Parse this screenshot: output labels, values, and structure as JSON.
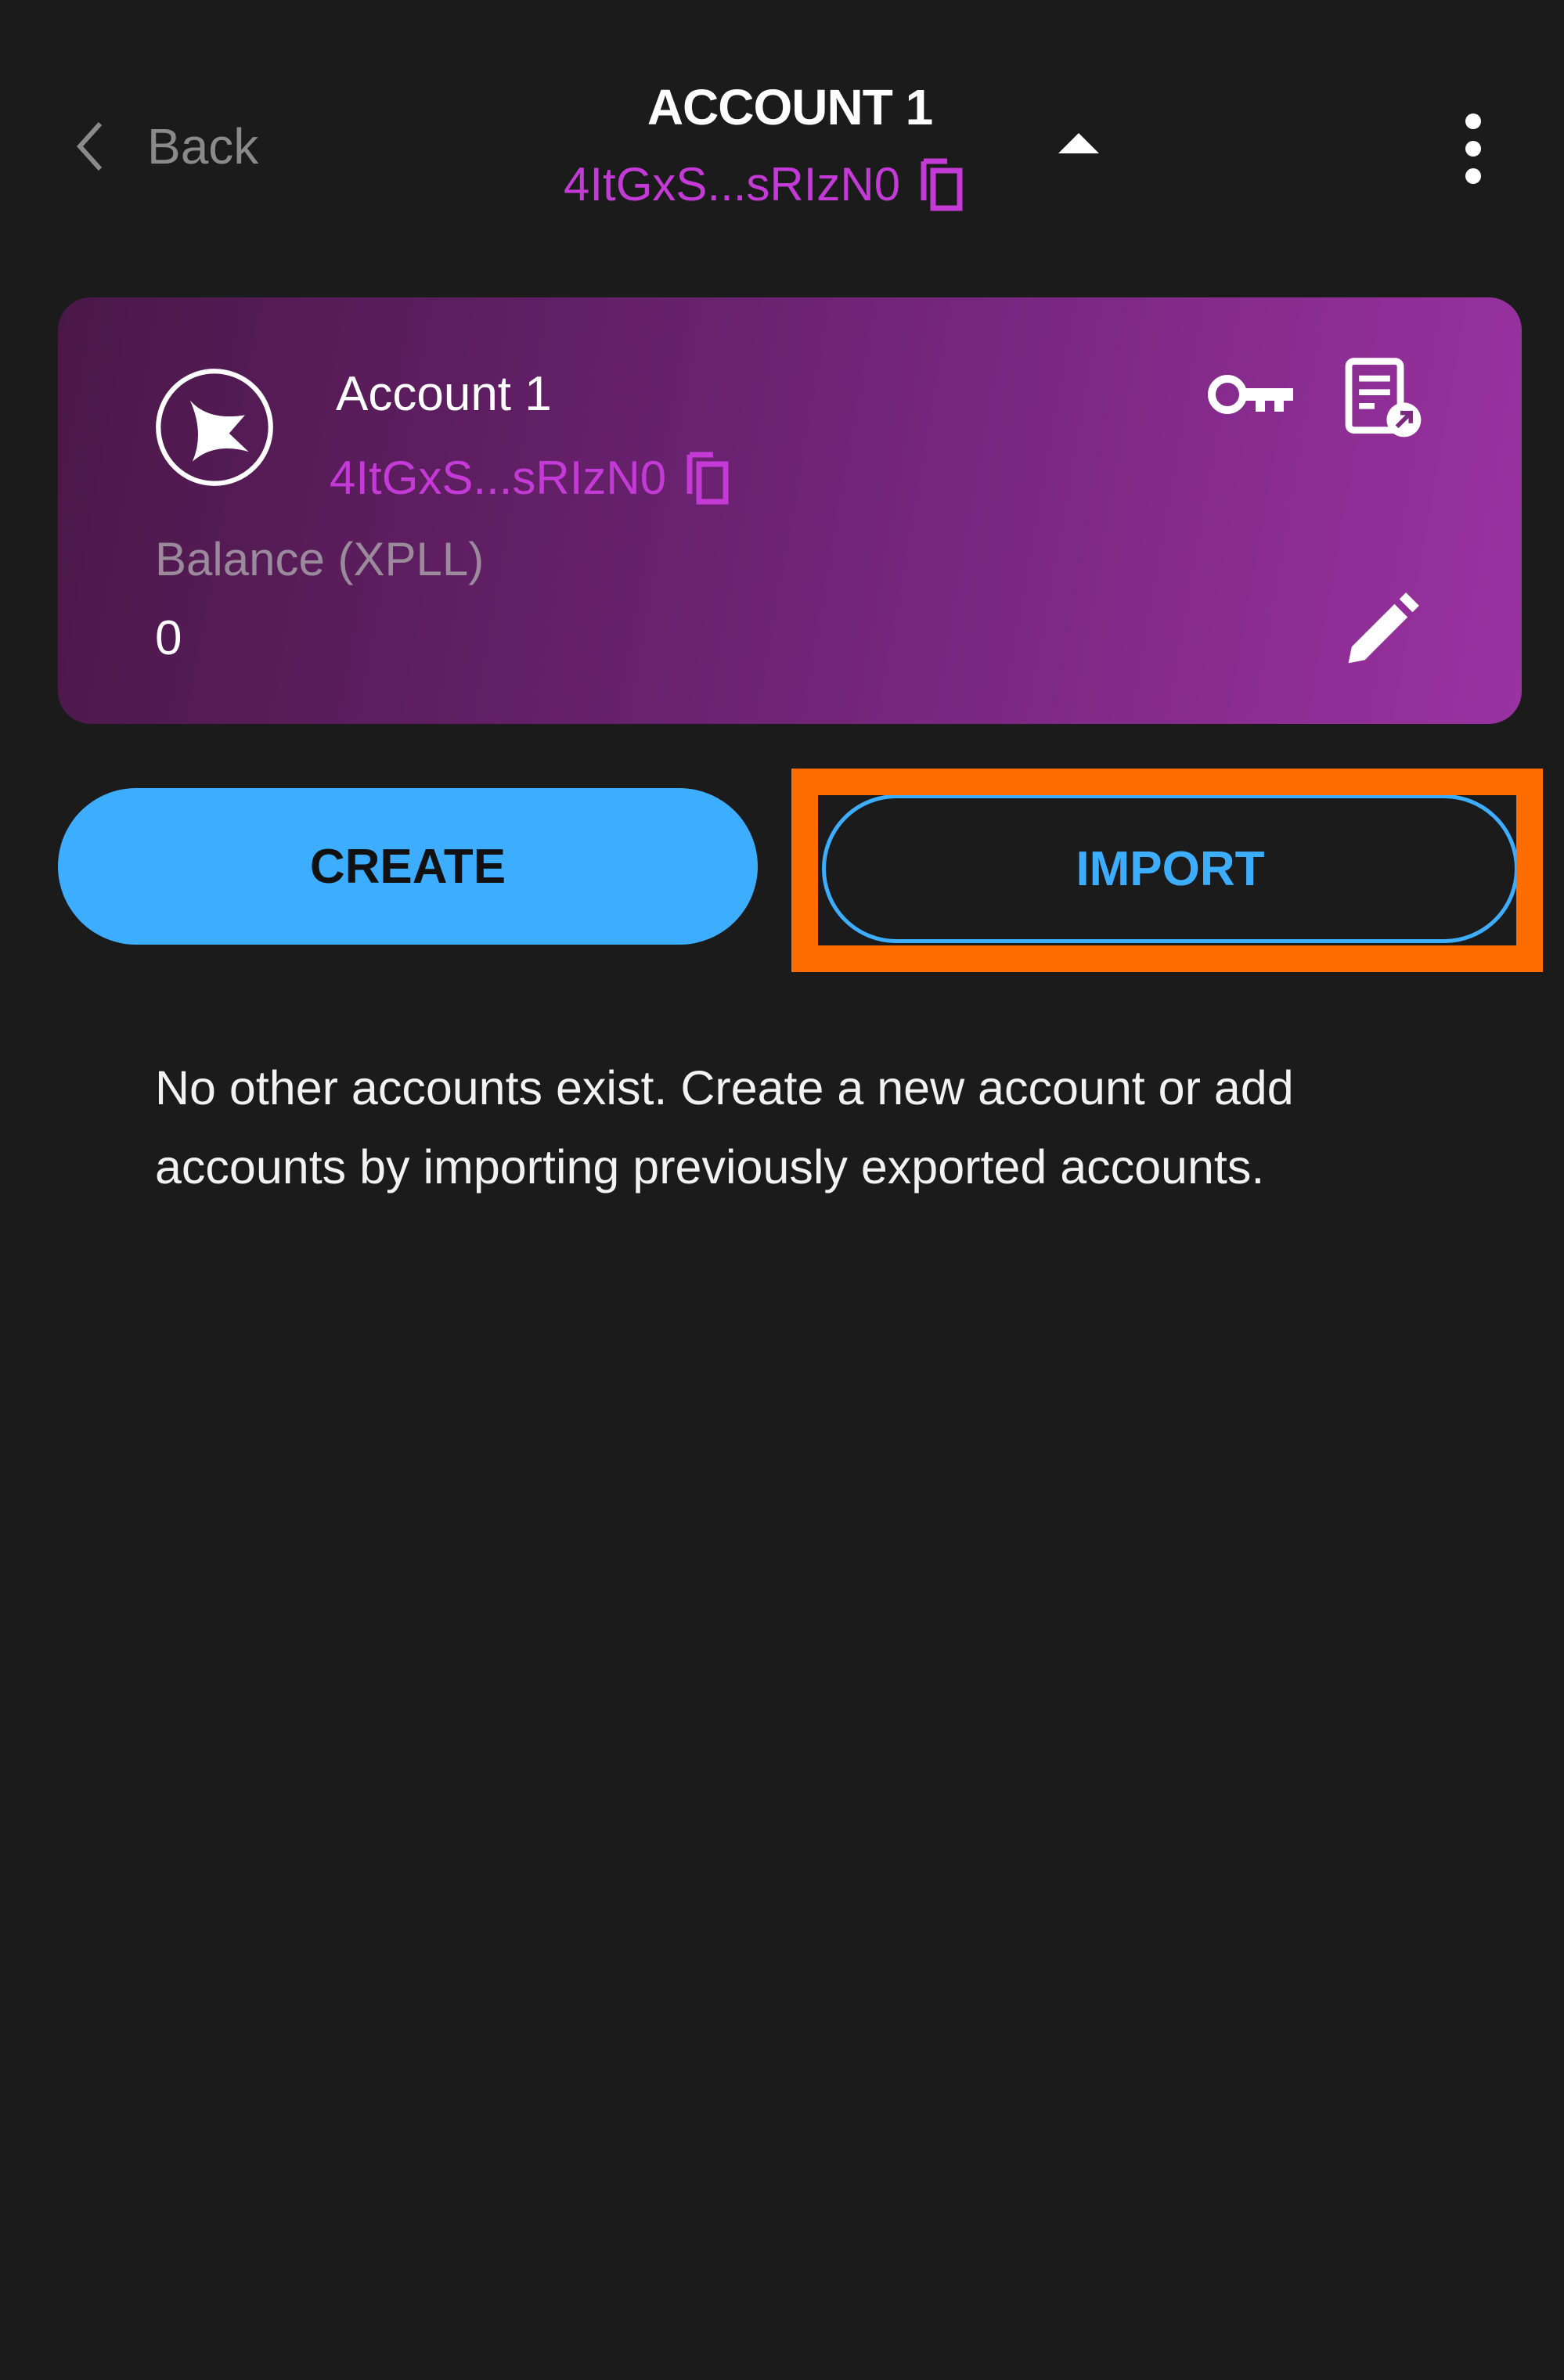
{
  "header": {
    "back_label": "Back",
    "title": "ACCOUNT 1",
    "address": "4ItGxS...sRIzN0"
  },
  "card": {
    "account_name": "Account 1",
    "address": "4ItGxS...sRIzN0",
    "balance_label": "Balance (XPLL)",
    "balance_value": "0"
  },
  "actions": {
    "create_label": "CREATE",
    "import_label": "IMPORT"
  },
  "message": "No other accounts exist. Create a new account or add accounts by importing previously exported accounts.",
  "colors": {
    "background": "#1b1b1b",
    "accent_blue": "#3daeff",
    "address_purple": "#c43ad6",
    "highlight_orange": "#ff6d00"
  }
}
